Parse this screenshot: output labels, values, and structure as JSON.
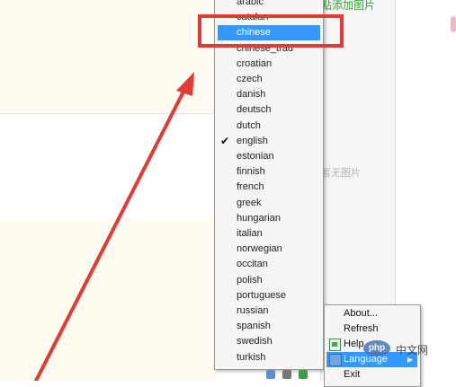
{
  "background": {
    "add_image_text": "點添加图片",
    "no_image_text": "暂无图片"
  },
  "language_menu": {
    "items": [
      {
        "label": "arabic"
      },
      {
        "label": "catalan"
      },
      {
        "label": "chinese",
        "selected": true
      },
      {
        "label": "chinese_trad"
      },
      {
        "label": "croatian"
      },
      {
        "label": "czech"
      },
      {
        "label": "danish"
      },
      {
        "label": "deutsch"
      },
      {
        "label": "dutch"
      },
      {
        "label": "english",
        "checked": true
      },
      {
        "label": "estonian"
      },
      {
        "label": "finnish"
      },
      {
        "label": "french"
      },
      {
        "label": "greek"
      },
      {
        "label": "hungarian"
      },
      {
        "label": "italian"
      },
      {
        "label": "norwegian"
      },
      {
        "label": "occitan"
      },
      {
        "label": "polish"
      },
      {
        "label": "portuguese"
      },
      {
        "label": "russian"
      },
      {
        "label": "spanish"
      },
      {
        "label": "swedish"
      },
      {
        "label": "turkish"
      }
    ],
    "check_glyph": "✔",
    "selection_color": "#3399ff"
  },
  "tray_menu": {
    "about": "About...",
    "refresh": "Refresh",
    "help": "Help",
    "language": "Language",
    "exit": "Exit",
    "submenu_arrow": "▶"
  },
  "watermark": {
    "logo_text": "php",
    "site_text": "中文网"
  },
  "annotation": {
    "color": "#e53935"
  }
}
